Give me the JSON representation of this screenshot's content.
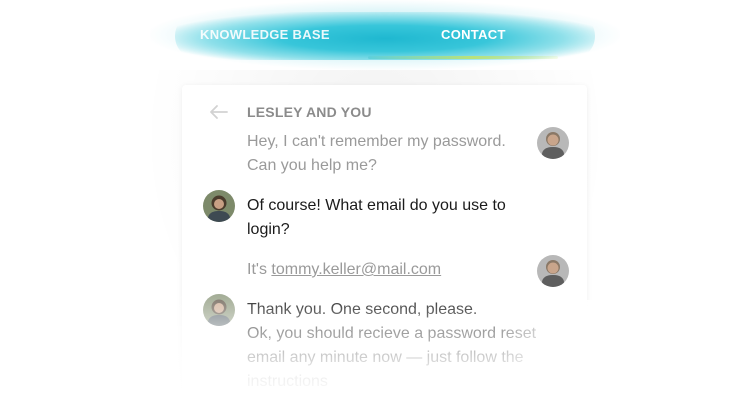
{
  "nav": {
    "tabs": [
      {
        "label": "KNOWLEDGE BASE"
      },
      {
        "label": "CONTACT"
      }
    ],
    "active_tab": "CONTACT",
    "colors": {
      "bar": "#1fb8d0",
      "underline_start": "#5fd0dc",
      "underline_end": "#b9e27a"
    }
  },
  "chat": {
    "title": "LESLEY AND YOU",
    "back_icon": "arrow-left-icon",
    "messages": [
      {
        "from": "user",
        "text_line1": "Hey, I can't remember my password.",
        "text_line2": "Can you help me?"
      },
      {
        "from": "agent",
        "text_line1": "Of course! What email do you use to",
        "text_line2": "login?"
      },
      {
        "from": "user",
        "prefix": "It's ",
        "email": "tommy.keller@mail.com"
      },
      {
        "from": "agent",
        "text_line1": "Thank you. One second, please.",
        "text_line2": "Ok, you should recieve a password reset",
        "text_line3": "email any minute now — just follow the",
        "text_line4": "instructions"
      }
    ]
  }
}
